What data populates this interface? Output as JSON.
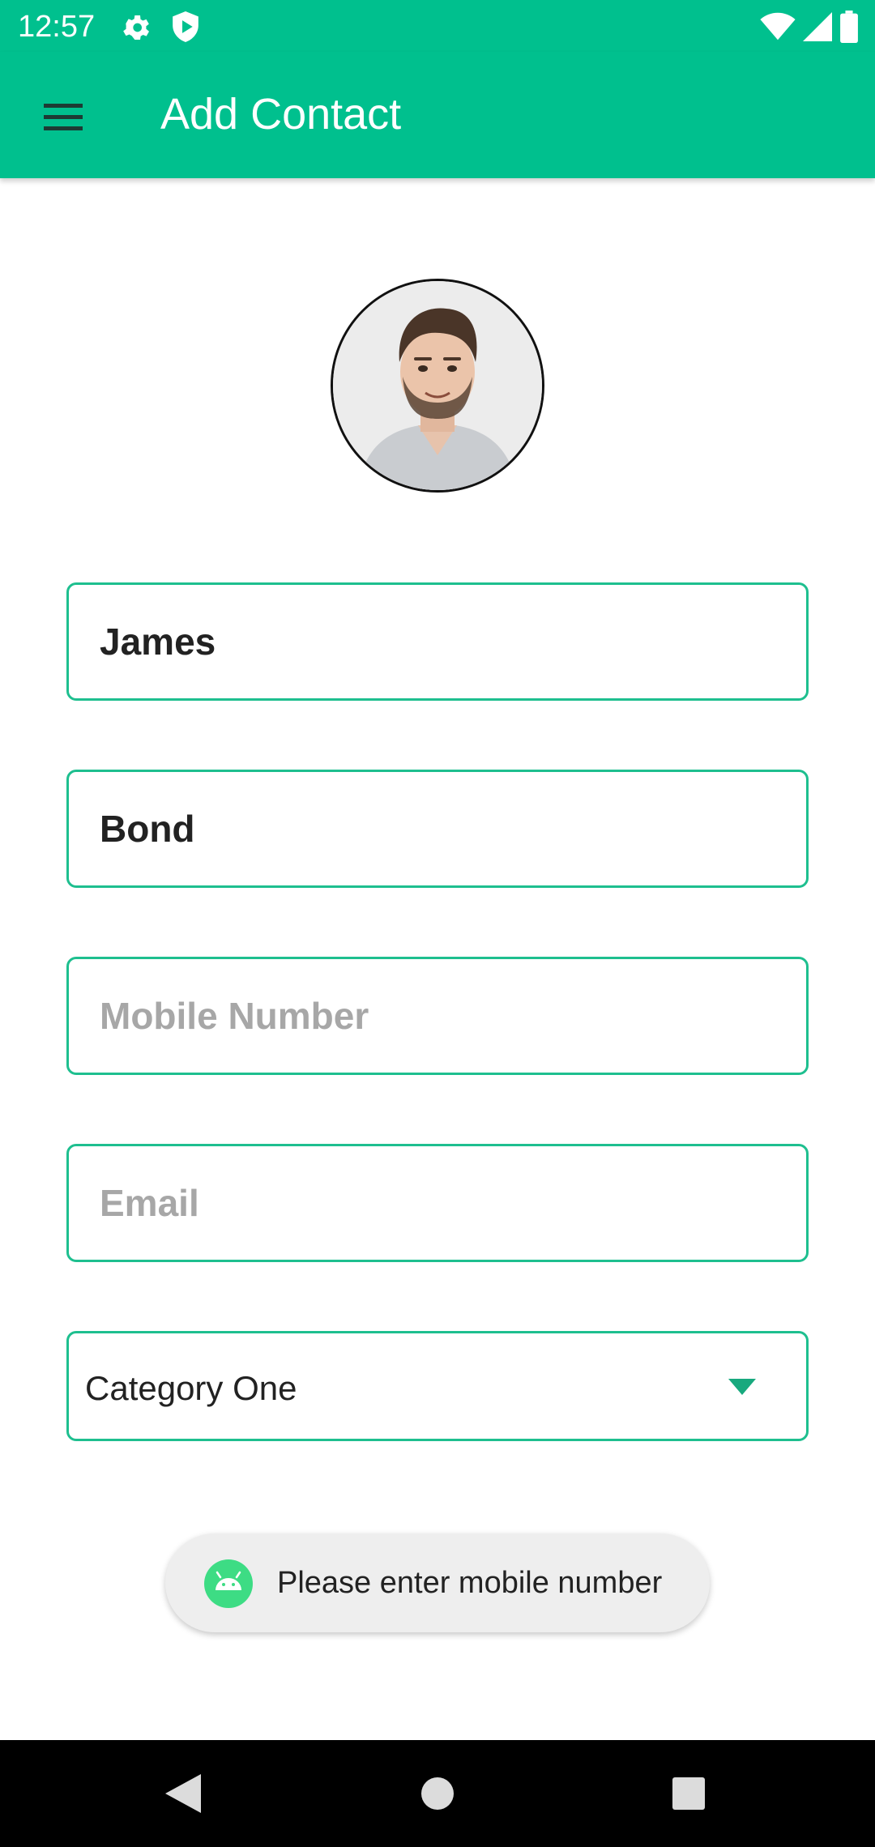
{
  "status_bar": {
    "time": "12:57",
    "icons": [
      "gear-icon",
      "shield-icon",
      "wifi-icon",
      "signal-icon",
      "battery-icon"
    ]
  },
  "app_bar": {
    "title": "Add Contact",
    "menu_icon": "hamburger-menu-icon"
  },
  "avatar": {
    "description": "contact-photo"
  },
  "form": {
    "first_name": {
      "value": "James",
      "placeholder": ""
    },
    "last_name": {
      "value": "Bond",
      "placeholder": ""
    },
    "mobile": {
      "value": "",
      "placeholder": "Mobile Number"
    },
    "email": {
      "value": "",
      "placeholder": "Email"
    },
    "category": {
      "selected": "Category One",
      "icon": "dropdown-arrow-icon"
    }
  },
  "toast": {
    "message": "Please enter mobile number",
    "icon": "android-icon"
  },
  "nav_bar": {
    "icons": [
      "back-icon",
      "home-icon",
      "recents-icon"
    ]
  },
  "colors": {
    "accent": "#00c08e",
    "field_border": "#1ebf8f",
    "toast_bg": "#eeeeee",
    "nav_bg": "#000000"
  }
}
